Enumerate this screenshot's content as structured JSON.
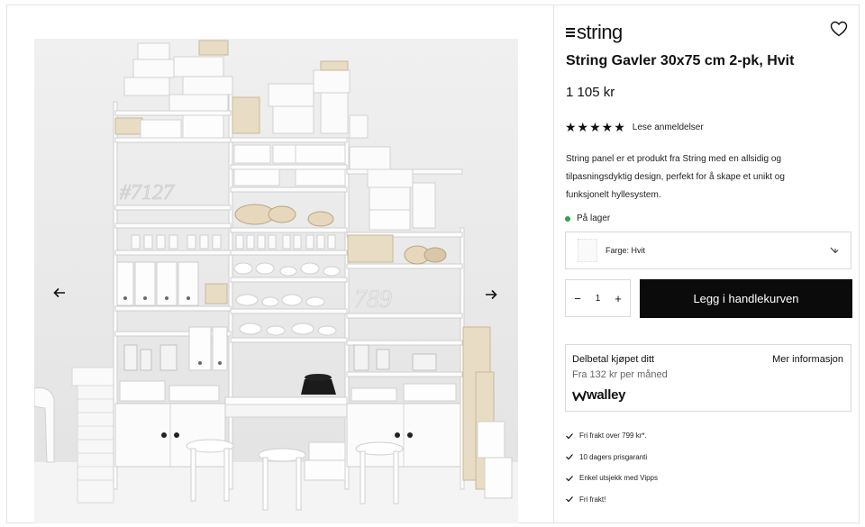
{
  "product": {
    "brand": "string",
    "title": "String Gavler 30x75 cm 2-pk, Hvit",
    "price": "1 105 kr",
    "rating": {
      "stars": "★★★★★",
      "value": 5,
      "reviews_link": "Lese anmeldelser"
    },
    "description": "String panel er et produkt fra String med en allsidig og tilpasningsdyktig design, perfekt for å skape et unikt og funksjonelt hyllesystem.",
    "stock": "På lager",
    "variant": {
      "label": "Farge: Hvit"
    },
    "quantity": "1",
    "add_to_cart": "Legg i handlekurven"
  },
  "payment": {
    "title": "Delbetal kjøpet ditt",
    "more_info": "Mer informasjon",
    "subtitle": "Fra 132 kr per måned",
    "provider": "walley"
  },
  "usps": [
    {
      "label": "Fri frakt over 799 kr*."
    },
    {
      "label": "10 dagers prisgaranti"
    },
    {
      "label": "Enkel utsjekk med Vipps"
    },
    {
      "label": "Fri frakt!"
    }
  ],
  "icons": {
    "heart": "heart-icon",
    "prev": "arrow-left-icon",
    "next": "arrow-right-icon",
    "chevron": "chevron-down-icon",
    "check": "check-icon"
  },
  "colors": {
    "accent": "#0b0b0b",
    "stock_dot": "#2fa24a",
    "border": "#d9d9d9"
  }
}
